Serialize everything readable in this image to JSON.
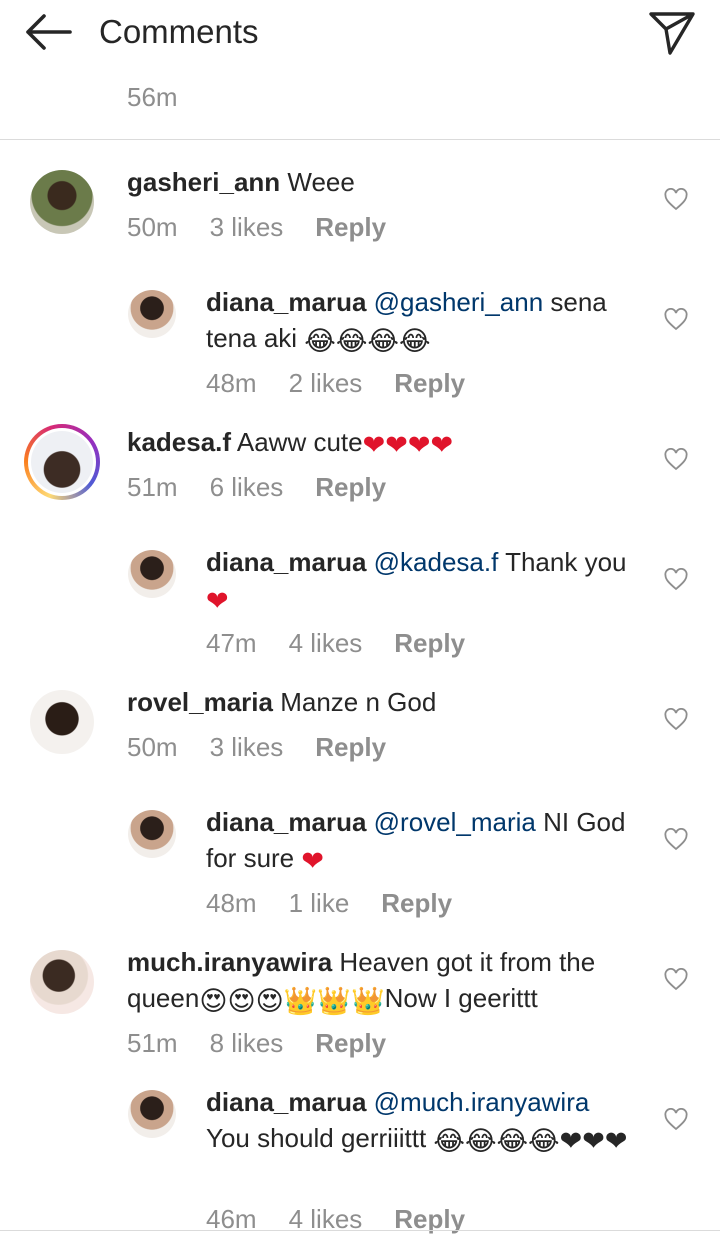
{
  "header": {
    "title": "Comments"
  },
  "previous": {
    "time": "56m"
  },
  "comments": [
    {
      "user": "gasheri_ann",
      "text": " Weee",
      "time": "50m",
      "likes": "3 likes",
      "reply": "Reply"
    },
    {
      "user": "diana_marua",
      "mention": "@gasheri_ann",
      "text": " sena tena aki ",
      "emoji": "😂😂😂😂",
      "time": "48m",
      "likes": "2 likes",
      "reply": "Reply"
    },
    {
      "user": "kadesa.f",
      "text": " Aaww cute",
      "emoji": "❤❤❤❤",
      "time": "51m",
      "likes": "6 likes",
      "reply": "Reply"
    },
    {
      "user": "diana_marua",
      "mention": "@kadesa.f",
      "text": " Thank you ",
      "emoji": "❤",
      "time": "47m",
      "likes": "4 likes",
      "reply": "Reply"
    },
    {
      "user": "rovel_maria",
      "text": " Manze n God",
      "time": "50m",
      "likes": "3 likes",
      "reply": "Reply"
    },
    {
      "user": "diana_marua",
      "mention": "@rovel_maria",
      "text": " NI God for sure ",
      "emoji": "❤",
      "time": "48m",
      "likes": "1 like",
      "reply": "Reply"
    },
    {
      "user": "much.iranyawira",
      "text": " Heaven got it from the queen",
      "emoji": "😍😍😍👑👑👑",
      "text2": "Now I geerittt",
      "time": "51m",
      "likes": "8 likes",
      "reply": "Reply"
    },
    {
      "user": "diana_marua",
      "mention": "@much.iranyawira",
      "text": " You should  gerriiittt ",
      "emoji": "😂😂😂😂❤❤❤",
      "time": "46m",
      "likes": "4 likes",
      "reply": "Reply"
    }
  ],
  "colors": {
    "link": "#00376b",
    "muted": "#8e8e8e",
    "heart": "#e0142b"
  }
}
